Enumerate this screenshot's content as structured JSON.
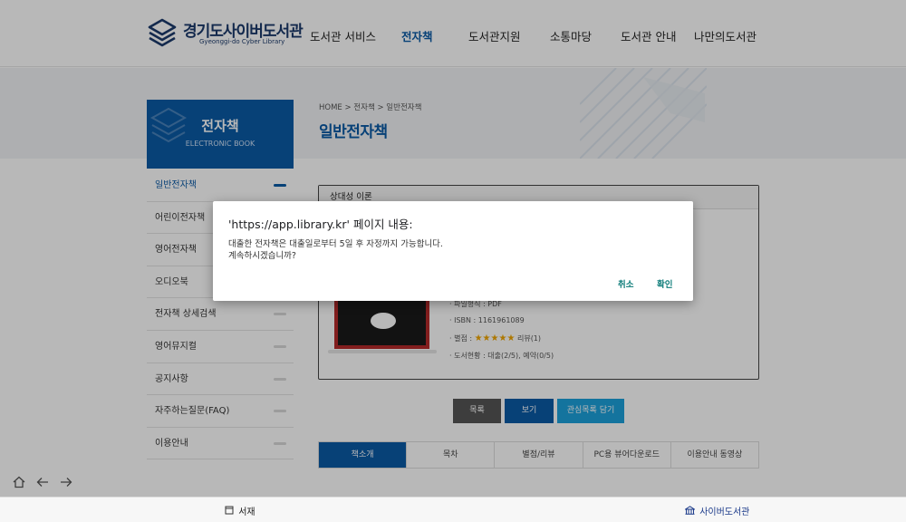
{
  "header": {
    "logo_title": "경기도사이버도서관",
    "logo_sub": "Gyeonggi-do Cyber Library",
    "nav": [
      "도서관 서비스",
      "전자책",
      "도서관지원",
      "소통마당",
      "도서관 안내",
      "나만의도서관"
    ],
    "active_nav": "전자책"
  },
  "sidebar": {
    "title": "전자책",
    "subtitle": "ELECTRONIC BOOK",
    "items": [
      {
        "label": "일반전자책"
      },
      {
        "label": "어린이전자책"
      },
      {
        "label": "영어전자책"
      },
      {
        "label": "오디오북"
      },
      {
        "label": "전자책 상세검색"
      },
      {
        "label": "영어뮤지컬"
      },
      {
        "label": "공지사항"
      },
      {
        "label": "자주하는질문(FAQ)"
      },
      {
        "label": "이용안내"
      }
    ]
  },
  "content": {
    "breadcrumb": "HOME > 전자책 > 일반전자책",
    "page_title": "일반전자책",
    "book_title": "상대성 이론",
    "meta": {
      "format": "· 파일형식 : PDF",
      "isbn": "· ISBN : 1161961089",
      "rating_label": "· 별점 :",
      "stars": "★★★★★",
      "review": "리뷰(1)",
      "status": "· 도서현황 : 대출(2/5), 예약(0/5)"
    },
    "buttons": {
      "list": "목록",
      "view": "보기",
      "wishlist": "관심목록 담기"
    },
    "tabs": [
      "책소개",
      "목차",
      "별점/리뷰",
      "PC용 뷰어다운로드",
      "이용안내 동영상"
    ]
  },
  "bottombar": {
    "shelf": "서재",
    "cyber": "사이버도서관"
  },
  "dialog": {
    "title": "'https://app.library.kr' 페이지 내용:",
    "message_line1": "대출한 전자책은 대출일로부터 5일 후 자정까지 가능합니다.",
    "message_line2": "계속하시겠습니까?",
    "cancel": "취소",
    "confirm": "확인"
  },
  "colors": {
    "brand": "#0b5aa6",
    "star": "#f0a500",
    "dialog_button": "#0f7d7a"
  },
  "icons": [
    "home-icon",
    "back-arrow-icon",
    "forward-arrow-icon",
    "book-icon",
    "library-icon",
    "logo-books-icon"
  ]
}
